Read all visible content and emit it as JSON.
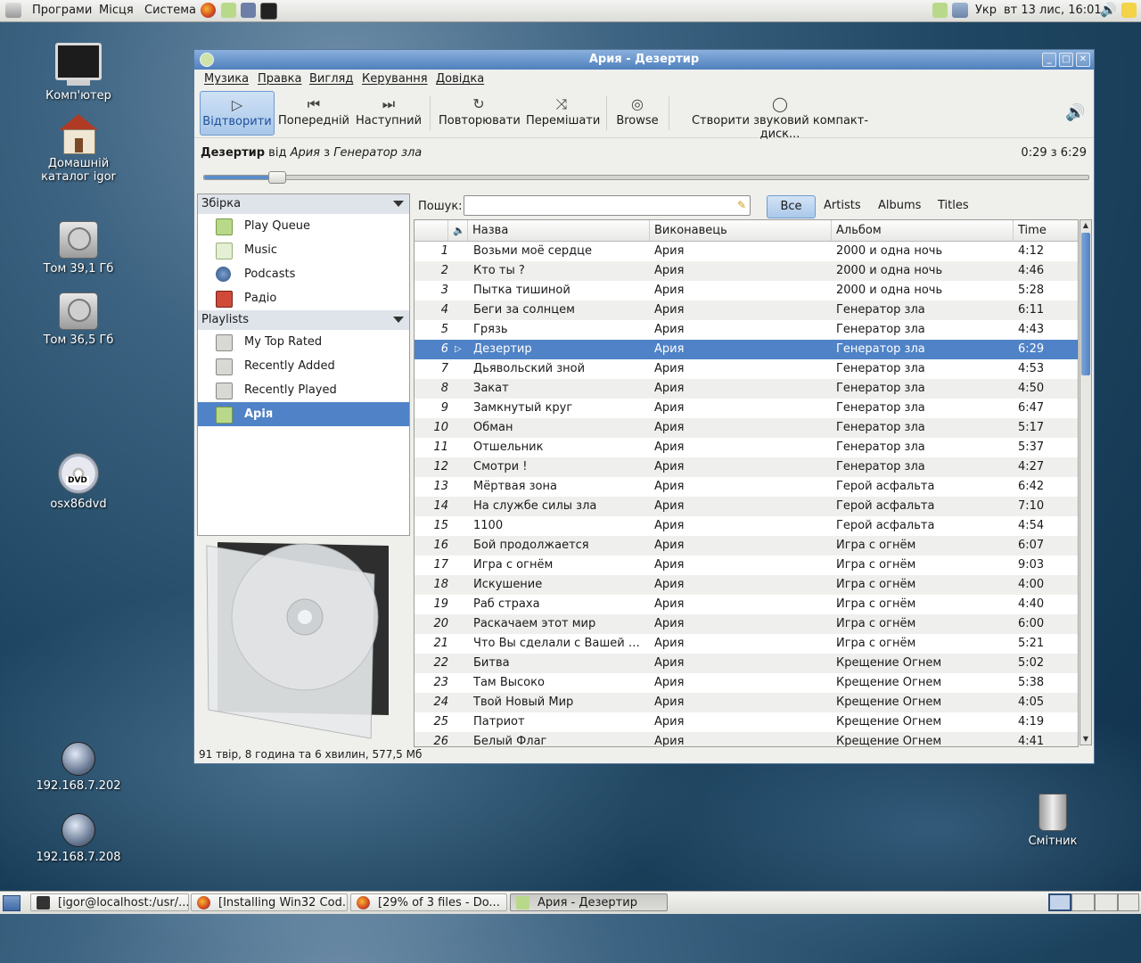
{
  "top_panel": {
    "menus": [
      "Програми",
      "Місця",
      "Система"
    ],
    "keyboard_layout": "Укр",
    "clock": "вт 13 лис, 16:01"
  },
  "desktop_icons": [
    "Комп'ютер",
    "Домашній каталог igor",
    "Том 39,1 Гб",
    "Том 36,5 Гб",
    "osx86dvd",
    "192.168.7.202",
    "192.168.7.208",
    "Смітник"
  ],
  "window": {
    "title": "Ария - Дезертир",
    "menu": [
      "Музика",
      "Правка",
      "Вигляд",
      "Керування",
      "Довідка"
    ],
    "toolbar": {
      "play": "Відтворити",
      "previous": "Попередній",
      "next": "Наступний",
      "repeat": "Повторювати",
      "shuffle": "Перемішати",
      "browse": "Browse",
      "burn": "Створити звуковий компакт-диск..."
    },
    "now_playing": {
      "title": "Дезертир",
      "by": "від",
      "artist": "Ария",
      "from": "з",
      "album": "Генератор зла"
    },
    "time_info": "0:29 з 6:29",
    "progress_fraction": 0.075,
    "sidebar": {
      "library_header": "Збірка",
      "library": [
        "Play Queue",
        "Music",
        "Podcasts",
        "Радіо"
      ],
      "playlists_header": "Playlists",
      "playlists": [
        "My Top Rated",
        "Recently Added",
        "Recently Played",
        "Арія"
      ]
    },
    "search": {
      "label": "Пошук:",
      "value": ""
    },
    "filters": [
      "Все",
      "Artists",
      "Albums",
      "Titles"
    ],
    "columns": {
      "title": "Назва",
      "artist": "Виконавець",
      "album": "Альбом",
      "time": "Time"
    },
    "tracks": [
      {
        "n": "1",
        "title": "Возьми моё сердце",
        "artist": "Ария",
        "album": "2000 и одна ночь",
        "time": "4:12"
      },
      {
        "n": "2",
        "title": "Кто ты ?",
        "artist": "Ария",
        "album": "2000 и одна ночь",
        "time": "4:46"
      },
      {
        "n": "3",
        "title": "Пытка тишиной",
        "artist": "Ария",
        "album": "2000 и одна ночь",
        "time": "5:28"
      },
      {
        "n": "4",
        "title": "Беги за солнцем",
        "artist": "Ария",
        "album": "Генератор зла",
        "time": "6:11"
      },
      {
        "n": "5",
        "title": "Грязь",
        "artist": "Ария",
        "album": "Генератор зла",
        "time": "4:43"
      },
      {
        "n": "6",
        "title": "Дезертир",
        "artist": "Ария",
        "album": "Генератор зла",
        "time": "6:29"
      },
      {
        "n": "7",
        "title": "Дьявольский зной",
        "artist": "Ария",
        "album": "Генератор зла",
        "time": "4:53"
      },
      {
        "n": "8",
        "title": "Закат",
        "artist": "Ария",
        "album": "Генератор зла",
        "time": "4:50"
      },
      {
        "n": "9",
        "title": "Замкнутый круг",
        "artist": "Ария",
        "album": "Генератор зла",
        "time": "6:47"
      },
      {
        "n": "10",
        "title": "Обман",
        "artist": "Ария",
        "album": "Генератор зла",
        "time": "5:17"
      },
      {
        "n": "11",
        "title": "Отшельник",
        "artist": "Ария",
        "album": "Генератор зла",
        "time": "5:37"
      },
      {
        "n": "12",
        "title": "Смотри !",
        "artist": "Ария",
        "album": "Генератор зла",
        "time": "4:27"
      },
      {
        "n": "13",
        "title": "Мёртвая зона",
        "artist": "Ария",
        "album": "Герой асфальта",
        "time": "6:42"
      },
      {
        "n": "14",
        "title": "На службе силы зла",
        "artist": "Ария",
        "album": "Герой асфальта",
        "time": "7:10"
      },
      {
        "n": "15",
        "title": "1100",
        "artist": "Ария",
        "album": "Герой асфальта",
        "time": "4:54"
      },
      {
        "n": "16",
        "title": "Бой продолжается",
        "artist": "Ария",
        "album": "Игра с огнём",
        "time": "6:07"
      },
      {
        "n": "17",
        "title": "Игра с огнём",
        "artist": "Ария",
        "album": "Игра с огнём",
        "time": "9:03"
      },
      {
        "n": "18",
        "title": "Искушение",
        "artist": "Ария",
        "album": "Игра с огнём",
        "time": "4:00"
      },
      {
        "n": "19",
        "title": "Раб страха",
        "artist": "Ария",
        "album": "Игра с огнём",
        "time": "4:40"
      },
      {
        "n": "20",
        "title": "Раскачаем этот мир",
        "artist": "Ария",
        "album": "Игра с огнём",
        "time": "6:00"
      },
      {
        "n": "21",
        "title": "Что Вы сделали с Вашей ме…",
        "artist": "Ария",
        "album": "Игра с огнём",
        "time": "5:21"
      },
      {
        "n": "22",
        "title": "Битва",
        "artist": "Ария",
        "album": "Крещение Огнем",
        "time": "5:02"
      },
      {
        "n": "23",
        "title": "Там Высоко",
        "artist": "Ария",
        "album": "Крещение Огнем",
        "time": "5:38"
      },
      {
        "n": "24",
        "title": "Твой Новый Мир",
        "artist": "Ария",
        "album": "Крещение Огнем",
        "time": "4:05"
      },
      {
        "n": "25",
        "title": "Патриот",
        "artist": "Ария",
        "album": "Крещение Огнем",
        "time": "4:19"
      },
      {
        "n": "26",
        "title": "Белый Флаг",
        "artist": "Ария",
        "album": "Крещение Огнем",
        "time": "4:41"
      }
    ],
    "playing_index": 5,
    "status": "91 твір, 8 година та 6 хвилин, 577,5 Мб"
  },
  "taskbar": [
    "[igor@localhost:/usr/...",
    "[Installing Win32 Cod...",
    "[29% of 3 files - Do...",
    "Ария - Дезертир"
  ]
}
